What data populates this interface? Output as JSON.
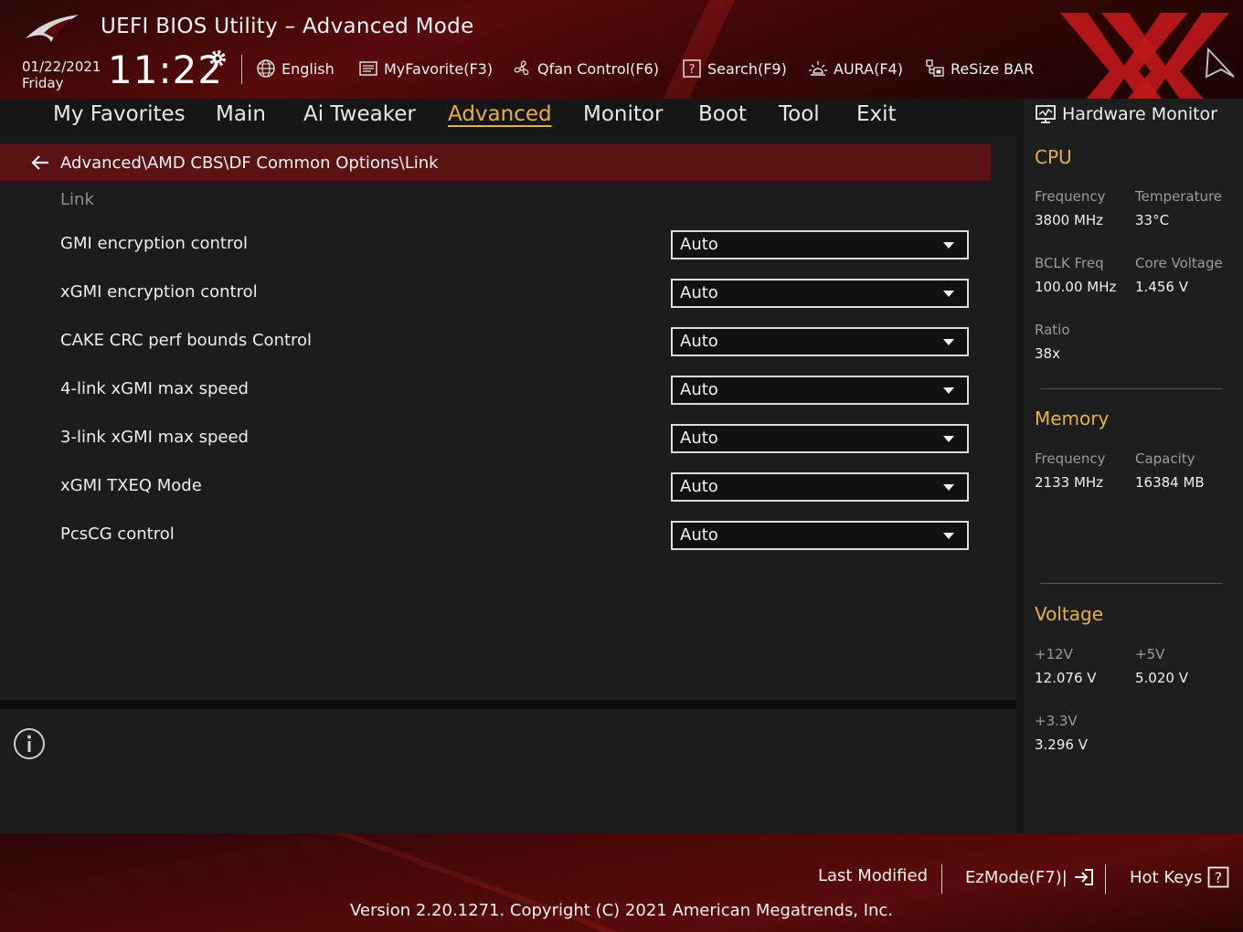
{
  "header": {
    "title": "UEFI BIOS Utility – Advanced Mode",
    "date": "01/22/2021",
    "day": "Friday",
    "time": "11:22",
    "toolbar": [
      {
        "label": "English",
        "icon": "globe-icon"
      },
      {
        "label": "MyFavorite(F3)",
        "icon": "favorite-list-icon"
      },
      {
        "label": "Qfan Control(F6)",
        "icon": "fan-icon"
      },
      {
        "label": "Search(F9)",
        "icon": "search-help-icon"
      },
      {
        "label": "AURA(F4)",
        "icon": "aura-light-icon"
      },
      {
        "label": "ReSize BAR",
        "icon": "resize-bar-icon"
      }
    ]
  },
  "tabs": [
    {
      "label": "My Favorites"
    },
    {
      "label": "Main"
    },
    {
      "label": "Ai Tweaker"
    },
    {
      "label": "Advanced",
      "active": true
    },
    {
      "label": "Monitor"
    },
    {
      "label": "Boot"
    },
    {
      "label": "Tool"
    },
    {
      "label": "Exit"
    }
  ],
  "breadcrumb": "Advanced\\AMD CBS\\DF Common Options\\Link",
  "section_label": "Link",
  "settings": [
    {
      "label": "GMI encryption control",
      "value": "Auto"
    },
    {
      "label": "xGMI encryption control",
      "value": "Auto"
    },
    {
      "label": "CAKE CRC perf bounds Control",
      "value": "Auto"
    },
    {
      "label": "4-link xGMI max speed",
      "value": "Auto"
    },
    {
      "label": "3-link xGMI max speed",
      "value": "Auto"
    },
    {
      "label": "xGMI TXEQ Mode",
      "value": "Auto"
    },
    {
      "label": "PcsCG control",
      "value": "Auto"
    }
  ],
  "hardware_monitor": {
    "title": "Hardware Monitor",
    "cpu": {
      "title": "CPU",
      "frequency_label": "Frequency",
      "frequency": "3800 MHz",
      "temperature_label": "Temperature",
      "temperature": "33°C",
      "bclk_label": "BCLK Freq",
      "bclk": "100.00 MHz",
      "core_voltage_label": "Core Voltage",
      "core_voltage": "1.456 V",
      "ratio_label": "Ratio",
      "ratio": "38x"
    },
    "memory": {
      "title": "Memory",
      "frequency_label": "Frequency",
      "frequency": "2133 MHz",
      "capacity_label": "Capacity",
      "capacity": "16384 MB"
    },
    "voltage": {
      "title": "Voltage",
      "v12_label": "+12V",
      "v12": "12.076 V",
      "v5_label": "+5V",
      "v5": "5.020 V",
      "v33_label": "+3.3V",
      "v33": "3.296 V"
    }
  },
  "footer": {
    "last_modified": "Last Modified",
    "ezmode": "EzMode(F7)|",
    "hotkeys": "Hot Keys",
    "copyright": "Version 2.20.1271. Copyright (C) 2021 American Megatrends, Inc."
  },
  "colors": {
    "accent": "#e5b04a",
    "breadcrumb_bg": "#5a1212",
    "watermark": "#c0181c"
  }
}
